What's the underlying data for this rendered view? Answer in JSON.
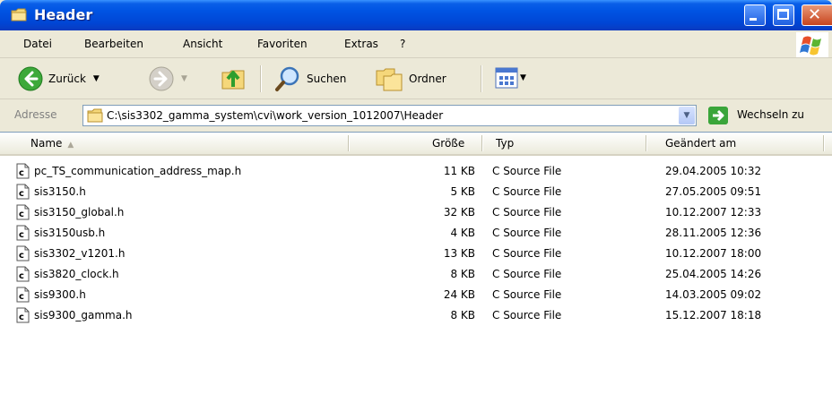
{
  "window": {
    "title": "Header"
  },
  "menu": [
    {
      "label": "Datei"
    },
    {
      "label": "Bearbeiten"
    },
    {
      "label": "Ansicht"
    },
    {
      "label": "Favoriten"
    },
    {
      "label": "Extras"
    },
    {
      "label": "?"
    }
  ],
  "toolbar": {
    "back_label": "Zurück",
    "search_label": "Suchen",
    "folders_label": "Ordner"
  },
  "address": {
    "label": "Adresse",
    "path": "C:\\sis3302_gamma_system\\cvi\\work_version_1012007\\Header",
    "go_label": "Wechseln zu"
  },
  "columns": {
    "name": "Name",
    "size": "Größe",
    "type": "Typ",
    "modified": "Geändert am"
  },
  "files": [
    {
      "name": "pc_TS_communication_address_map.h",
      "size": "11 KB",
      "type": "C Source File",
      "modified": "29.04.2005 10:32"
    },
    {
      "name": "sis3150.h",
      "size": "5 KB",
      "type": "C Source File",
      "modified": "27.05.2005 09:51"
    },
    {
      "name": "sis3150_global.h",
      "size": "32 KB",
      "type": "C Source File",
      "modified": "10.12.2007 12:33"
    },
    {
      "name": "sis3150usb.h",
      "size": "4 KB",
      "type": "C Source File",
      "modified": "28.11.2005 12:36"
    },
    {
      "name": "sis3302_v1201.h",
      "size": "13 KB",
      "type": "C Source File",
      "modified": "10.12.2007 18:00"
    },
    {
      "name": "sis3820_clock.h",
      "size": "8 KB",
      "type": "C Source File",
      "modified": "25.04.2005 14:26"
    },
    {
      "name": "sis9300.h",
      "size": "24 KB",
      "type": "C Source File",
      "modified": "14.03.2005 09:02"
    },
    {
      "name": "sis9300_gamma.h",
      "size": "8 KB",
      "type": "C Source File",
      "modified": "15.12.2007 18:18"
    }
  ],
  "icons": {
    "window": "folder-icon",
    "back": "back-arrow-icon",
    "forward": "forward-arrow-icon",
    "up": "folder-up-icon",
    "search": "search-icon",
    "folders": "folders-icon",
    "views": "views-icon",
    "go": "go-arrow-icon",
    "file": "c-source-file-icon"
  },
  "colors": {
    "titlebar": "#0054E3",
    "background": "#ECE9D8",
    "list": "#FFFFFF"
  }
}
